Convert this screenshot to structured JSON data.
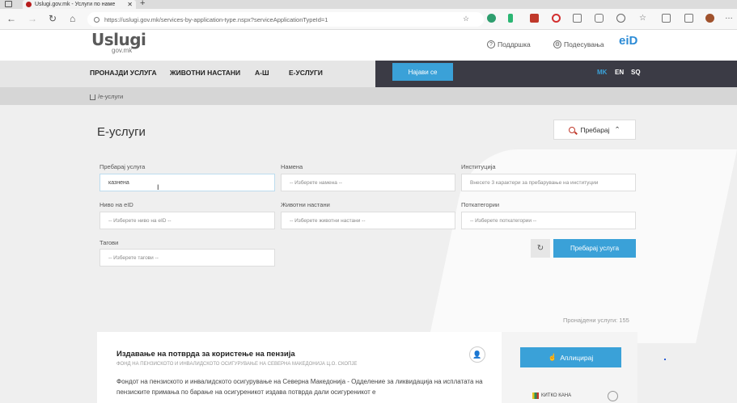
{
  "browser": {
    "tab_title": "Uslugi.gov.mk - Услуги по наме",
    "tab_close": "✕",
    "new_tab": "+",
    "url": "https://uslugi.gov.mk/services-by-application-type.nspx?serviceApplicationTypeId=1"
  },
  "header": {
    "logo": "Uslugi",
    "logo_sub": "gov.mk",
    "support": "Поддршка",
    "settings": "Подесувања",
    "eid": "eiD"
  },
  "nav": {
    "items": [
      "ПРОНАЈДИ УСЛУГА",
      "ЖИВОТНИ НАСТАНИ",
      "А-Ш",
      "Е-УСЛУГИ"
    ],
    "login": "Најави се",
    "langs": [
      "MK",
      "EN",
      "SQ"
    ],
    "active_lang": "MK"
  },
  "breadcrumb": "/е-услуги",
  "main": {
    "title": "Е-услуги",
    "search_toggle": "Пребарај",
    "filters": {
      "search_label": "Пребарај услуга",
      "search_value": "казнена",
      "purpose_label": "Намена",
      "purpose_placeholder": "-- Изберете намена --",
      "institution_label": "Институција",
      "institution_placeholder": "Внесете 3 карактери за пребарување на институции",
      "eid_label": "Ниво на eID",
      "eid_placeholder": "-- Изберете ниво на eID --",
      "life_label": "Животни настани",
      "life_placeholder": "-- Изберете животни настани --",
      "subcat_label": "Поткатегории",
      "subcat_placeholder": "-- Изберете поткатегории --",
      "tags_label": "Тагови",
      "tags_placeholder": "-- Изберете тагови --"
    },
    "reset_glyph": "↻",
    "search_button": "Пребарај услуга",
    "found": "Пронајдени услуги: 155",
    "card": {
      "title": "Издавање на потврда за користење на пензија",
      "subtitle": "ФОНД НА ПЕНЗИСКОТО И ИНВАЛИДСКОТО ОСИГУРУВАЊЕ НА СЕВЕРНА МАКЕДОНИЈА Ц.О. СКОПЈЕ",
      "description": "Фондот на пензиското и инвалидското осигурување на Северна Македонија - Одделение за ликвидација на исплатата на пензиските примања по барање на осигуреникот издава потврда дали осигуреникот е",
      "apply": "Аплицирај",
      "side_logo": "КИТКО КАНА"
    }
  },
  "colors": {
    "accent": "#3aa1d8",
    "nav_dark": "#3b3b45",
    "brand_red": "#c0392b"
  }
}
